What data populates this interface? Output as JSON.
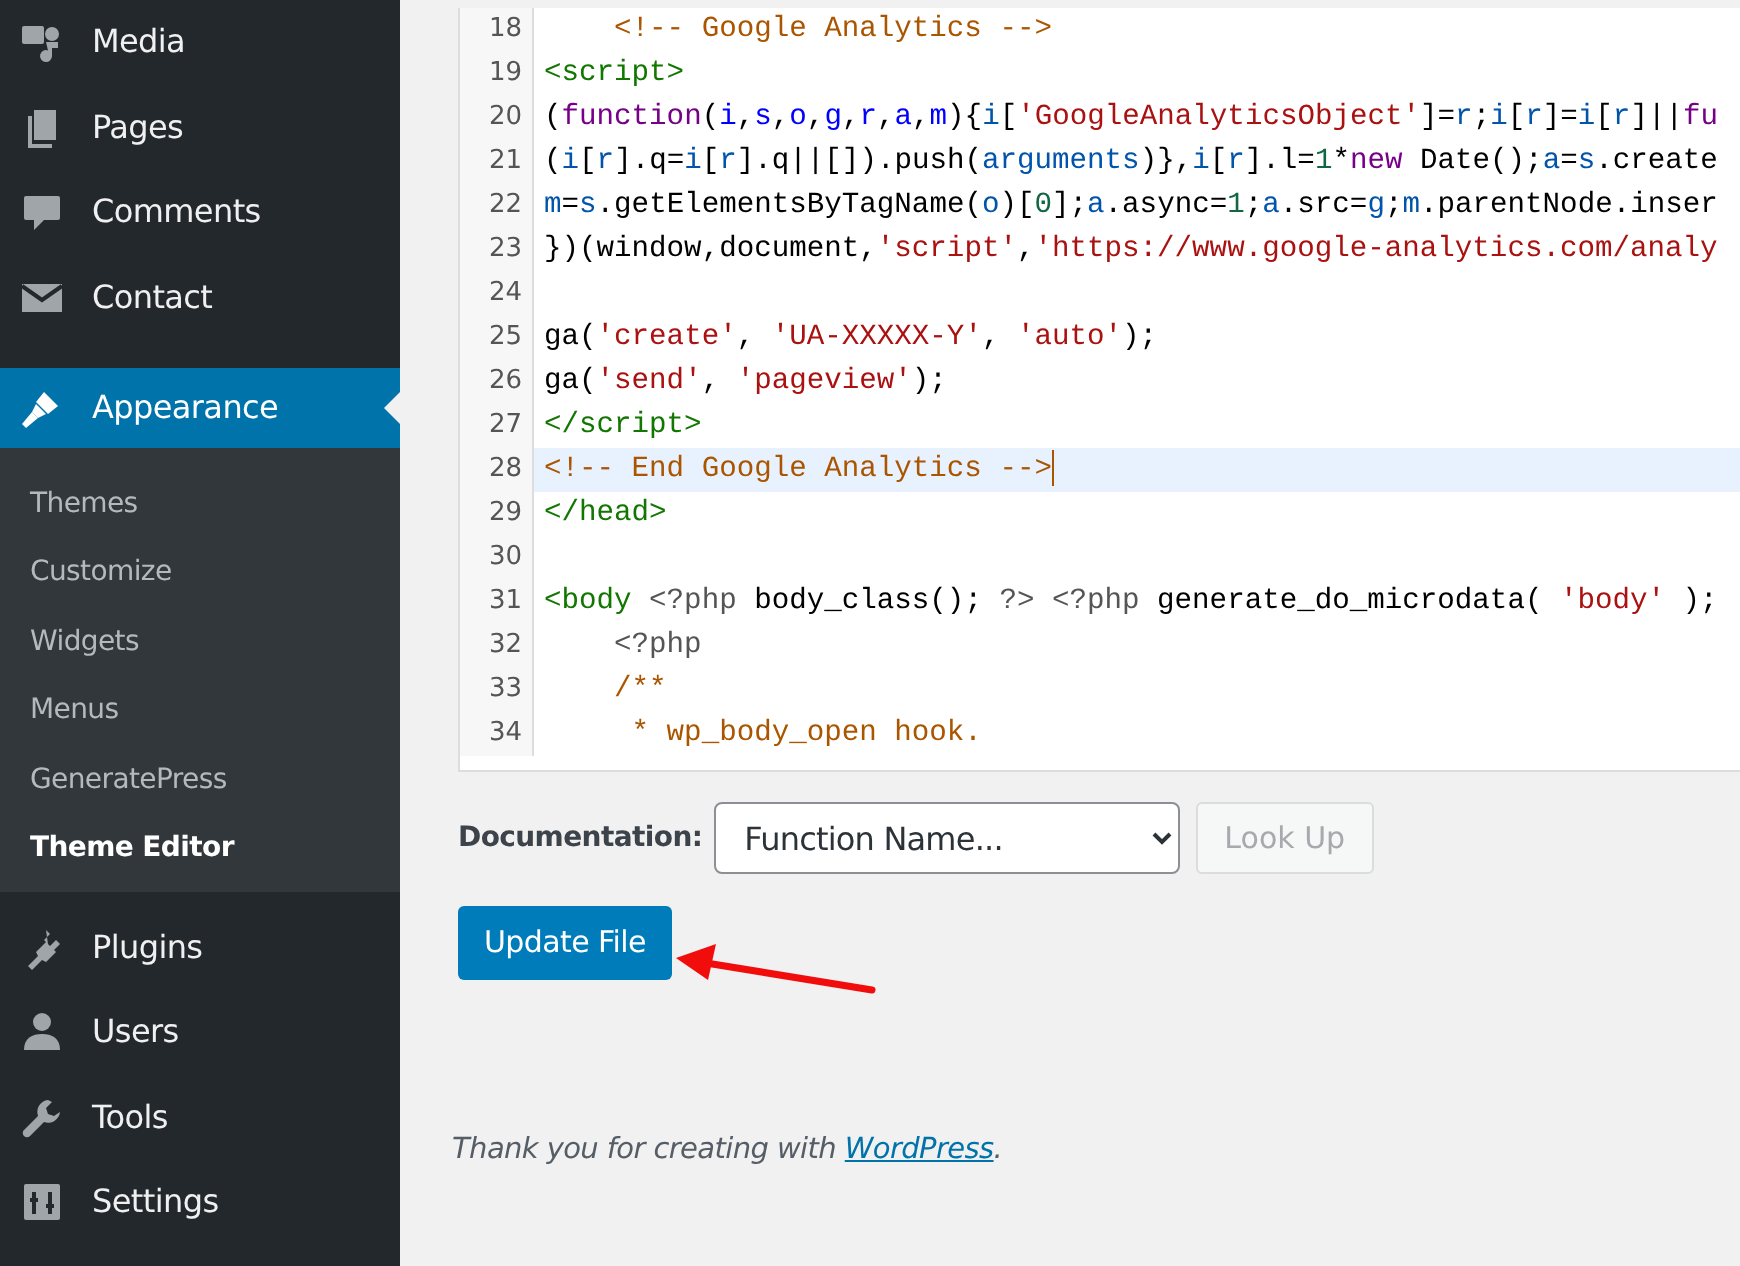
{
  "sidebar": {
    "items": [
      {
        "label": "Media",
        "selected": false
      },
      {
        "label": "Pages",
        "selected": false
      },
      {
        "label": "Comments",
        "selected": false
      },
      {
        "label": "Contact",
        "selected": false
      },
      {
        "label": "Appearance",
        "selected": true,
        "children": [
          {
            "label": "Themes",
            "selected": false
          },
          {
            "label": "Customize",
            "selected": false
          },
          {
            "label": "Widgets",
            "selected": false
          },
          {
            "label": "Menus",
            "selected": false
          },
          {
            "label": "GeneratePress",
            "selected": false
          },
          {
            "label": "Theme Editor",
            "selected": true
          }
        ]
      },
      {
        "label": "Plugins",
        "selected": false
      },
      {
        "label": "Users",
        "selected": false
      },
      {
        "label": "Tools",
        "selected": false
      },
      {
        "label": "Settings",
        "selected": false
      }
    ]
  },
  "editor": {
    "lines": [
      {
        "number": "18",
        "active": false,
        "tokens": [
          {
            "kind": "comment",
            "text": "    <!-- Google Analytics -->"
          }
        ]
      },
      {
        "number": "19",
        "active": false,
        "tokens": [
          {
            "kind": "tag",
            "text": "<script>"
          }
        ]
      },
      {
        "number": "20",
        "active": false,
        "tokens": [
          {
            "kind": "plain",
            "text": "("
          },
          {
            "kind": "keyword",
            "text": "function"
          },
          {
            "kind": "plain",
            "text": "("
          },
          {
            "kind": "def",
            "text": "i"
          },
          {
            "kind": "plain",
            "text": ","
          },
          {
            "kind": "def",
            "text": "s"
          },
          {
            "kind": "plain",
            "text": ","
          },
          {
            "kind": "def",
            "text": "o"
          },
          {
            "kind": "plain",
            "text": ","
          },
          {
            "kind": "def",
            "text": "g"
          },
          {
            "kind": "plain",
            "text": ","
          },
          {
            "kind": "def",
            "text": "r"
          },
          {
            "kind": "plain",
            "text": ","
          },
          {
            "kind": "def",
            "text": "a"
          },
          {
            "kind": "plain",
            "text": ","
          },
          {
            "kind": "def",
            "text": "m"
          },
          {
            "kind": "plain",
            "text": "){"
          },
          {
            "kind": "variable",
            "text": "i"
          },
          {
            "kind": "plain",
            "text": "["
          },
          {
            "kind": "string",
            "text": "'GoogleAnalyticsObject'"
          },
          {
            "kind": "plain",
            "text": "]="
          },
          {
            "kind": "variable",
            "text": "r"
          },
          {
            "kind": "plain",
            "text": ";"
          },
          {
            "kind": "variable",
            "text": "i"
          },
          {
            "kind": "plain",
            "text": "["
          },
          {
            "kind": "variable",
            "text": "r"
          },
          {
            "kind": "plain",
            "text": "]="
          },
          {
            "kind": "variable",
            "text": "i"
          },
          {
            "kind": "plain",
            "text": "["
          },
          {
            "kind": "variable",
            "text": "r"
          },
          {
            "kind": "plain",
            "text": "]||"
          },
          {
            "kind": "keyword",
            "text": "fu"
          }
        ]
      },
      {
        "number": "21",
        "active": false,
        "tokens": [
          {
            "kind": "plain",
            "text": "("
          },
          {
            "kind": "variable",
            "text": "i"
          },
          {
            "kind": "plain",
            "text": "["
          },
          {
            "kind": "variable",
            "text": "r"
          },
          {
            "kind": "plain",
            "text": "].q="
          },
          {
            "kind": "variable",
            "text": "i"
          },
          {
            "kind": "plain",
            "text": "["
          },
          {
            "kind": "variable",
            "text": "r"
          },
          {
            "kind": "plain",
            "text": "].q||[]).push("
          },
          {
            "kind": "variable",
            "text": "arguments"
          },
          {
            "kind": "plain",
            "text": ")},"
          },
          {
            "kind": "variable",
            "text": "i"
          },
          {
            "kind": "plain",
            "text": "["
          },
          {
            "kind": "variable",
            "text": "r"
          },
          {
            "kind": "plain",
            "text": "].l="
          },
          {
            "kind": "number",
            "text": "1"
          },
          {
            "kind": "plain",
            "text": "*"
          },
          {
            "kind": "keyword",
            "text": "new"
          },
          {
            "kind": "plain",
            "text": " Date();"
          },
          {
            "kind": "variable",
            "text": "a"
          },
          {
            "kind": "plain",
            "text": "="
          },
          {
            "kind": "variable",
            "text": "s"
          },
          {
            "kind": "plain",
            "text": ".create"
          }
        ]
      },
      {
        "number": "22",
        "active": false,
        "tokens": [
          {
            "kind": "variable",
            "text": "m"
          },
          {
            "kind": "plain",
            "text": "="
          },
          {
            "kind": "variable",
            "text": "s"
          },
          {
            "kind": "plain",
            "text": ".getElementsByTagName("
          },
          {
            "kind": "variable",
            "text": "o"
          },
          {
            "kind": "plain",
            "text": ")["
          },
          {
            "kind": "number",
            "text": "0"
          },
          {
            "kind": "plain",
            "text": "];"
          },
          {
            "kind": "variable",
            "text": "a"
          },
          {
            "kind": "plain",
            "text": ".async="
          },
          {
            "kind": "number",
            "text": "1"
          },
          {
            "kind": "plain",
            "text": ";"
          },
          {
            "kind": "variable",
            "text": "a"
          },
          {
            "kind": "plain",
            "text": ".src="
          },
          {
            "kind": "variable",
            "text": "g"
          },
          {
            "kind": "plain",
            "text": ";"
          },
          {
            "kind": "variable",
            "text": "m"
          },
          {
            "kind": "plain",
            "text": ".parentNode.inser"
          }
        ]
      },
      {
        "number": "23",
        "active": false,
        "tokens": [
          {
            "kind": "plain",
            "text": "})(window,document,"
          },
          {
            "kind": "string",
            "text": "'script'"
          },
          {
            "kind": "plain",
            "text": ","
          },
          {
            "kind": "string",
            "text": "'https://www.google-analytics.com/analy"
          }
        ]
      },
      {
        "number": "24",
        "active": false
      },
      {
        "number": "25",
        "active": false,
        "tokens": [
          {
            "kind": "plain",
            "text": "ga("
          },
          {
            "kind": "string",
            "text": "'create'"
          },
          {
            "kind": "plain",
            "text": ", "
          },
          {
            "kind": "string",
            "text": "'UA-XXXXX-Y'"
          },
          {
            "kind": "plain",
            "text": ", "
          },
          {
            "kind": "string",
            "text": "'auto'"
          },
          {
            "kind": "plain",
            "text": ");"
          }
        ]
      },
      {
        "number": "26",
        "active": false,
        "tokens": [
          {
            "kind": "plain",
            "text": "ga("
          },
          {
            "kind": "string",
            "text": "'send'"
          },
          {
            "kind": "plain",
            "text": ", "
          },
          {
            "kind": "string",
            "text": "'pageview'"
          },
          {
            "kind": "plain",
            "text": ");"
          }
        ]
      },
      {
        "number": "27",
        "active": false,
        "tokens": [
          {
            "kind": "tag",
            "text": "</script>"
          }
        ]
      },
      {
        "number": "28",
        "active": true,
        "tokens": [
          {
            "kind": "comment",
            "text": "<!-- End Google Analytics -->"
          }
        ]
      },
      {
        "number": "29",
        "active": false,
        "tokens": [
          {
            "kind": "tag",
            "text": "</head>"
          }
        ]
      },
      {
        "number": "30",
        "active": false
      },
      {
        "number": "31",
        "active": false,
        "tokens": [
          {
            "kind": "tag",
            "text": "<body "
          },
          {
            "kind": "meta",
            "text": "<?php"
          },
          {
            "kind": "plain",
            "text": " body_class(); "
          },
          {
            "kind": "meta",
            "text": "?> <?php"
          },
          {
            "kind": "plain",
            "text": " generate_do_microdata( "
          },
          {
            "kind": "string",
            "text": "'body'"
          },
          {
            "kind": "plain",
            "text": " );"
          }
        ]
      },
      {
        "number": "32",
        "active": false,
        "tokens": [
          {
            "kind": "meta",
            "text": "    <?php"
          }
        ]
      },
      {
        "number": "33",
        "active": false,
        "tokens": [
          {
            "kind": "comment",
            "text": "    /**"
          }
        ]
      },
      {
        "number": "34",
        "active": false,
        "tokens": [
          {
            "kind": "comment",
            "text": "     * wp_body_open hook."
          }
        ]
      }
    ]
  },
  "documentation": {
    "label": "Documentation:",
    "select_value": "Function Name...",
    "lookup_button": {
      "label": "Look Up",
      "disabled": true
    }
  },
  "update_button": {
    "label": "Update File"
  },
  "footer": {
    "text": "Thank you for creating with ",
    "link": "WordPress",
    "suffix": "."
  }
}
